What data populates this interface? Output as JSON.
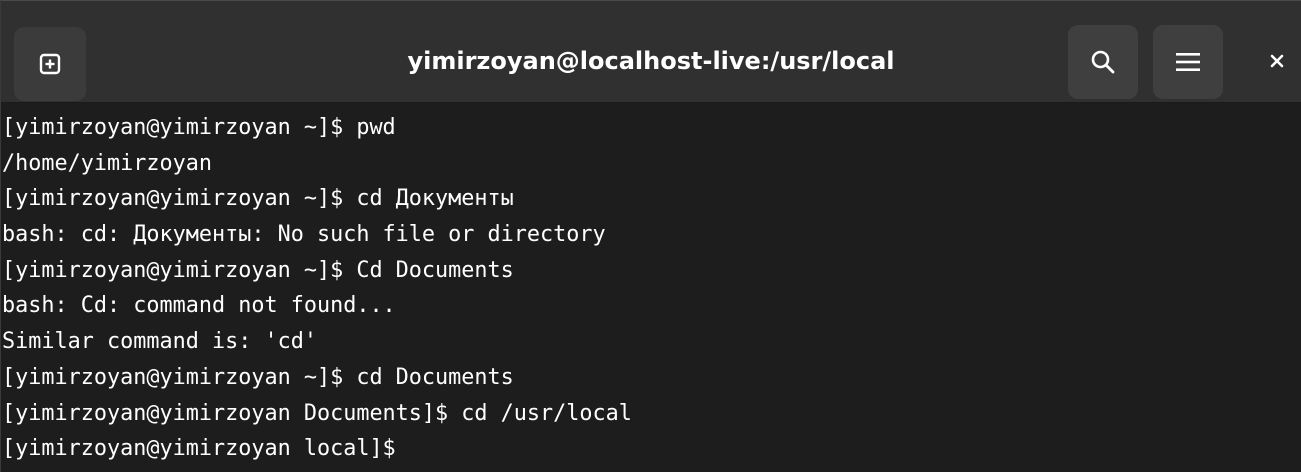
{
  "window": {
    "title": "yimirzoyan@localhost-live:/usr/local"
  },
  "headerbar": {
    "new_tab_icon": "new-tab-plus-icon",
    "search_icon": "search-icon",
    "menu_icon": "hamburger-menu-icon",
    "close_icon": "close-icon"
  },
  "colors": {
    "terminal_bg": "#1d1d1d",
    "headerbar_bg": "#303030",
    "button_bg": "#3f3f3f",
    "text": "#ffffff"
  },
  "terminal": {
    "lines": [
      "[yimirzoyan@yimirzoyan ~]$ pwd",
      "/home/yimirzoyan",
      "[yimirzoyan@yimirzoyan ~]$ cd Документы",
      "bash: cd: Документы: No such file or directory",
      "[yimirzoyan@yimirzoyan ~]$ Cd Documents",
      "bash: Cd: command not found...",
      "Similar command is: 'cd'",
      "[yimirzoyan@yimirzoyan ~]$ cd Documents",
      "[yimirzoyan@yimirzoyan Documents]$ cd /usr/local",
      "[yimirzoyan@yimirzoyan local]$ "
    ]
  }
}
